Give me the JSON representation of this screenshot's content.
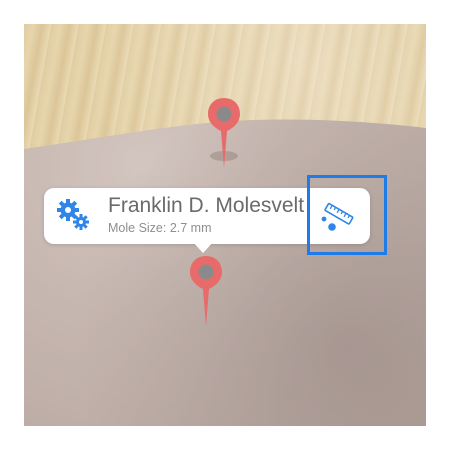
{
  "callout": {
    "title": "Franklin D. Molesvelt",
    "subtitle": "Mole Size: 2.7 mm",
    "left_icon": "gears-icon",
    "right_icon": "ruler-measure-icon"
  },
  "pins": [
    {
      "name": "mole-pin-upper",
      "color": "#e86b6b"
    },
    {
      "name": "mole-pin-lower",
      "color": "#e86b6b"
    }
  ],
  "colors": {
    "accent": "#2f86e8",
    "pin": "#e86b6b",
    "highlight": "#1f7be8"
  }
}
